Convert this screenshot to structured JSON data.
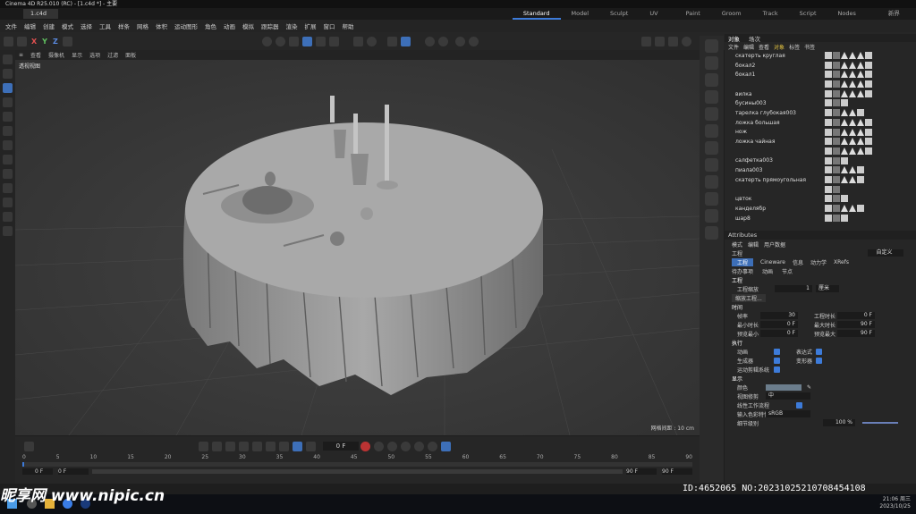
{
  "window_title": "Cinema 4D R25.010 (RC) - [1.c4d *] - 主要",
  "doc_tab": "1.c4d *",
  "layout_tabs": [
    "Standard",
    "Model",
    "Sculpt",
    "UV Edit",
    "Paint",
    "Groom",
    "Track",
    "Script",
    "Nodes"
  ],
  "new_layout": "新界面",
  "menu": [
    "文件",
    "编辑",
    "创建",
    "模式",
    "选择",
    "工具",
    "样条",
    "网格",
    "体积",
    "运动图形",
    "角色",
    "动画",
    "模拟",
    "跟踪器",
    "渲染",
    "扩展",
    "窗口",
    "帮助"
  ],
  "axes": [
    "X",
    "Y",
    "Z"
  ],
  "viewport_menu": [
    "查看",
    "摄像机",
    "显示",
    "选项",
    "过滤",
    "面板"
  ],
  "viewport_label": "透视视图",
  "grid_info": "网格间距 : 10 cm",
  "timeline": {
    "current_frame": "0 F",
    "start": "0 F",
    "start2": "0 F",
    "end": "90 F",
    "end2": "90 F",
    "ticks": [
      "0",
      "5",
      "10",
      "15",
      "20",
      "25",
      "30",
      "35",
      "40",
      "45",
      "50",
      "55",
      "60",
      "65",
      "70",
      "75",
      "80",
      "85",
      "90"
    ]
  },
  "objects_tabs": [
    "对象",
    "场次"
  ],
  "objects_menu": [
    "文件",
    "编辑",
    "查看",
    "对象",
    "标签",
    "书签"
  ],
  "objects": [
    "скатерть круглая",
    "бокал2",
    "бокал1",
    "",
    "вилка",
    "бусины003",
    "тарелка глубокая003",
    "ложка большая",
    "нож",
    "ложка чайная",
    "",
    "салфетка003",
    "пиала003",
    "скатерть прямоугольная",
    "",
    "цвток",
    "канделябр",
    "шар8"
  ],
  "attributes": {
    "title": "Attributes",
    "menu": [
      "模式",
      "编辑",
      "用户数据"
    ],
    "preset": "自定义",
    "section": "工程",
    "tabs": [
      "工程",
      "Cineware",
      "信息",
      "动力学",
      "XRefs"
    ],
    "tabs2": [
      "待办事项",
      "动画",
      "节点"
    ],
    "project_heading": "工程",
    "project_scale_label": "工程缩放",
    "project_scale": "1",
    "project_scale_unit": "厘米",
    "scale_button": "缩放工程...",
    "time_heading": "时间",
    "fps_label": "帧率",
    "fps": "30",
    "project_length_label": "工程时长",
    "project_length": "0 F",
    "min_time_label": "最小时长",
    "min_time": "0 F",
    "max_time_label": "最大时长",
    "max_time": "90 F",
    "preview_min_label": "预览最小",
    "preview_min": "0 F",
    "preview_max_label": "预览最大",
    "preview_max": "90 F",
    "exec_heading": "执行",
    "animation": "动画",
    "expression": "表达式",
    "generator": "生成器",
    "deformer": "变形器",
    "motion_system": "运动剪辑系统",
    "display_heading": "显示",
    "color_label": "颜色",
    "lod_label": "视图修剪",
    "lod_value": "中",
    "linear_workflow": "线性工作流程",
    "input_color_label": "输入色彩特性",
    "input_color": "sRGB",
    "detail_label": "细节级别",
    "detail_value": "100 %"
  },
  "taskbar": {
    "time": "21:06 周三",
    "date": "2023/10/25"
  },
  "watermark": "昵享网 www.nipic.cn",
  "id_line": "ID:4652065 NO:20231025210708454108"
}
